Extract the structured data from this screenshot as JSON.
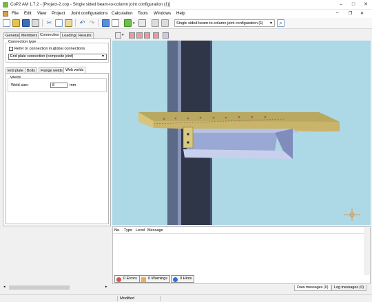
{
  "window": {
    "title": "CoP2 AM 1.7.2 - [Project-2.cop - Single sided beam-to-column joint configuration (1)]",
    "minimize": "–",
    "maximize": "□",
    "close": "✕"
  },
  "menu": [
    "File",
    "Edit",
    "View",
    "Project",
    "Joint configurations",
    "Calculation",
    "Tools",
    "Windows",
    "Help"
  ],
  "toolbar": {
    "joint_config_selected": "Single sided beam-to-column joint configuration (1)"
  },
  "tabs": [
    "General",
    "Members",
    "Connection",
    "Loading",
    "Results"
  ],
  "active_tab": "Connection",
  "connection": {
    "group_title": "Connection type",
    "refer_checkbox_label": "Refer to connection in global connections",
    "refer_checked": false,
    "type_value": "End plate connection (composite joint)"
  },
  "subtabs": [
    "End plate",
    "Bolts",
    "Flange welds",
    "Web welds"
  ],
  "active_subtab": "Web welds",
  "welds": {
    "group_title": "Welds",
    "weld_size_label": "Weld size:",
    "weld_size_value": "8",
    "weld_size_unit": "mm"
  },
  "messages": {
    "columns": [
      "No.",
      "Type",
      "Level",
      "Message"
    ],
    "errors_label": "0 Errors",
    "warnings_label": "0 Warnings",
    "hints_label": "0 Hints"
  },
  "bottom_tabs": [
    "Data messages (0)",
    "Log messages (0)"
  ],
  "status": {
    "modified": "Modified"
  },
  "colors": {
    "viewport_bg": "#add8e6",
    "column": "#3c4355",
    "beam": "#9aa8d4",
    "slab": "#c9b46a",
    "error_icon": "#d9534f",
    "warning_icon": "#f0ad4e",
    "hint_icon": "#2f6fd6"
  }
}
